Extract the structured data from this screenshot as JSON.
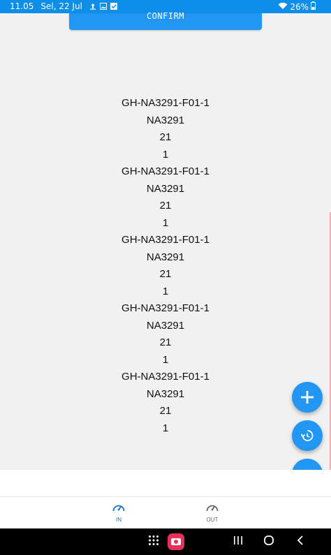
{
  "status_bar": {
    "time": "11.05",
    "date": "Sel, 22 Jul",
    "battery": "26%"
  },
  "confirm_button": {
    "label": "CONFIRM"
  },
  "records": [
    "GH-NA3291-F01-1",
    "NA3291",
    "21",
    "1",
    "GH-NA3291-F01-1",
    "NA3291",
    "21",
    "1",
    "GH-NA3291-F01-1",
    "NA3291",
    "21",
    "1",
    "GH-NA3291-F01-1",
    "NA3291",
    "21",
    "1",
    "GH-NA3291-F01-1",
    "NA3291",
    "21",
    "1"
  ],
  "fabs": {
    "add_icon": "plus-icon",
    "history_icon": "history-icon",
    "home_icon": "home-icon"
  },
  "bottom_nav": {
    "in_label": "IN",
    "out_label": "OUT",
    "active": "IN"
  },
  "colors": {
    "accent": "#2196f3",
    "status_bar": "#0d8ee8",
    "active_nav": "#1a73c8"
  }
}
